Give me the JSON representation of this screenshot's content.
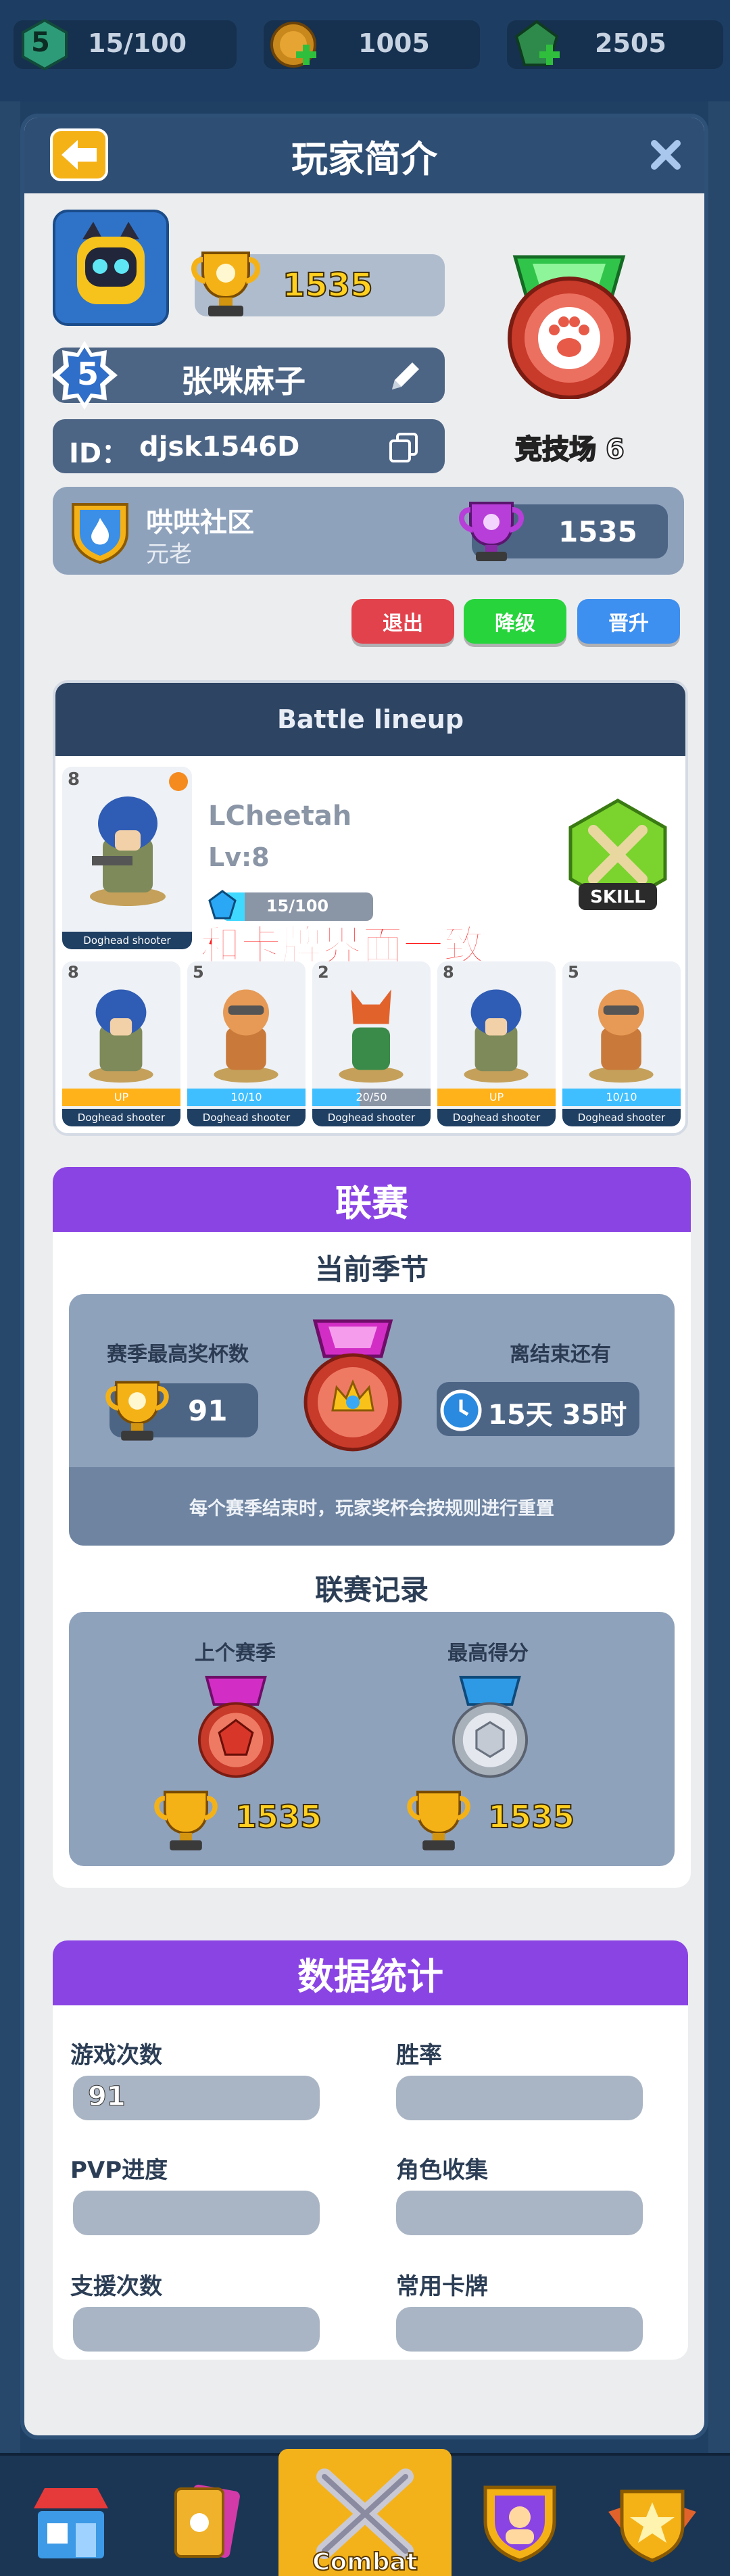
{
  "resources": {
    "level": "5",
    "xp": "15/100",
    "coins": "1005",
    "gems": "2505"
  },
  "panel": {
    "title": "玩家简介"
  },
  "profile": {
    "trophies": "1535",
    "level": "5",
    "name": "张咪麻子",
    "id_label": "ID：",
    "id_value": "djsk1546D",
    "arena": "竞技场 6"
  },
  "club": {
    "name": "哄哄社区",
    "role": "元老",
    "trophies": "1535"
  },
  "actions": {
    "exit": "退出",
    "demote": "降级",
    "promote": "晋升"
  },
  "lineup": {
    "title": "Battle lineup",
    "hero_name": "LCheetah",
    "hero_level": "Lv:8",
    "hero_xp": "15/100",
    "skill": "SKILL",
    "annotation": "和卡牌界面一致",
    "main_unit_label": "Doghead shooter",
    "main_unit_cost": "8",
    "units": [
      {
        "cost": "8",
        "label": "Doghead shooter",
        "bar": "UP"
      },
      {
        "cost": "5",
        "label": "Doghead shooter",
        "bar": "10/10"
      },
      {
        "cost": "2",
        "label": "Doghead shooter",
        "bar": "20/50"
      },
      {
        "cost": "8",
        "label": "Doghead shooter",
        "bar": "UP"
      },
      {
        "cost": "5",
        "label": "Doghead shooter",
        "bar": "10/10"
      }
    ]
  },
  "league": {
    "title": "联赛",
    "current_season": "当前季节",
    "max_trophies_label": "赛季最高奖杯数",
    "max_trophies": "91",
    "ends_in_label": "离结束还有",
    "ends_in": "15天 35时",
    "reset_note": "每个赛季结束时，玩家奖杯会按规则进行重置",
    "records_title": "联赛记录",
    "last_season_label": "上个赛季",
    "last_season_trophies": "1535",
    "best_score_label": "最高得分",
    "best_score_trophies": "1535"
  },
  "stats": {
    "title": "数据统计",
    "games_label": "游戏次数",
    "games_value": "91",
    "winrate_label": "胜率",
    "pvp_label": "PVP进度",
    "collection_label": "角色收集",
    "assists_label": "支援次数",
    "cards_label": "常用卡牌"
  },
  "nav": {
    "combat": "Combat"
  },
  "colors": {
    "header_navy": "#2f4e74",
    "league_purple": "#8a44e4",
    "exit_red": "#e2424c",
    "demote_green": "#27d43c",
    "promote_blue": "#3d8ff0",
    "trophy_gold": "#ffd020"
  }
}
